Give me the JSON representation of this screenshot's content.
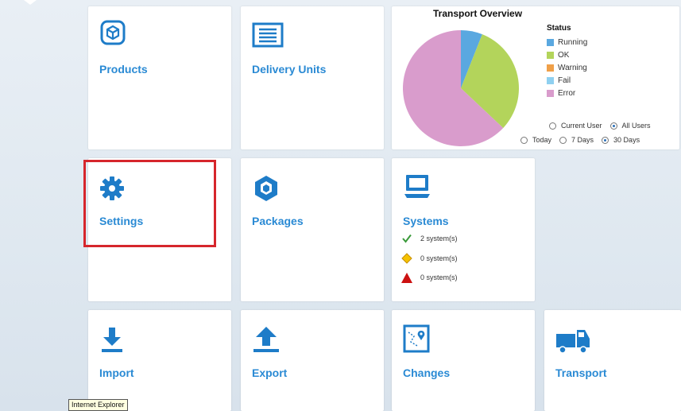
{
  "tiles": {
    "products": "Products",
    "delivery_units": "Delivery Units",
    "settings": "Settings",
    "packages": "Packages",
    "systems": "Systems",
    "import": "Import",
    "export": "Export",
    "changes": "Changes",
    "transport": "Transport"
  },
  "overview": {
    "title": "Transport Overview",
    "legend_title": "Status",
    "legend": [
      {
        "label": "Running",
        "color": "#5aa8e0"
      },
      {
        "label": "OK",
        "color": "#b3d45b"
      },
      {
        "label": "Warning",
        "color": "#f0a048"
      },
      {
        "label": "Fail",
        "color": "#8fd0f0"
      },
      {
        "label": "Error",
        "color": "#d99ccc"
      }
    ],
    "user_filter": {
      "current_user": "Current User",
      "all_users": "All Users",
      "selected": "All Users"
    },
    "time_filter": {
      "today": "Today",
      "seven_days": "7 Days",
      "thirty_days": "30 Days",
      "selected": "30 Days"
    }
  },
  "chart_data": {
    "type": "pie",
    "title": "Transport Overview",
    "legend_title": "Status",
    "slices": [
      {
        "label": "Running",
        "value": 6
      },
      {
        "label": "OK",
        "value": 31
      },
      {
        "label": "Warning",
        "value": 0
      },
      {
        "label": "Fail",
        "value": 0
      },
      {
        "label": "Error",
        "value": 63
      }
    ],
    "legend_placement": "right"
  },
  "systems_status": [
    {
      "icon": "check-icon",
      "text": "2 system(s)",
      "color": "#3a9a3a"
    },
    {
      "icon": "warning-diamond-icon",
      "text": "0 system(s)",
      "color": "#f0b400"
    },
    {
      "icon": "error-triangle-icon",
      "text": "0 system(s)",
      "color": "#cc1111"
    }
  ],
  "tooltip": "Internet Explorer",
  "colors": {
    "accent": "#2a8ad4",
    "highlight": "#d6262c"
  }
}
